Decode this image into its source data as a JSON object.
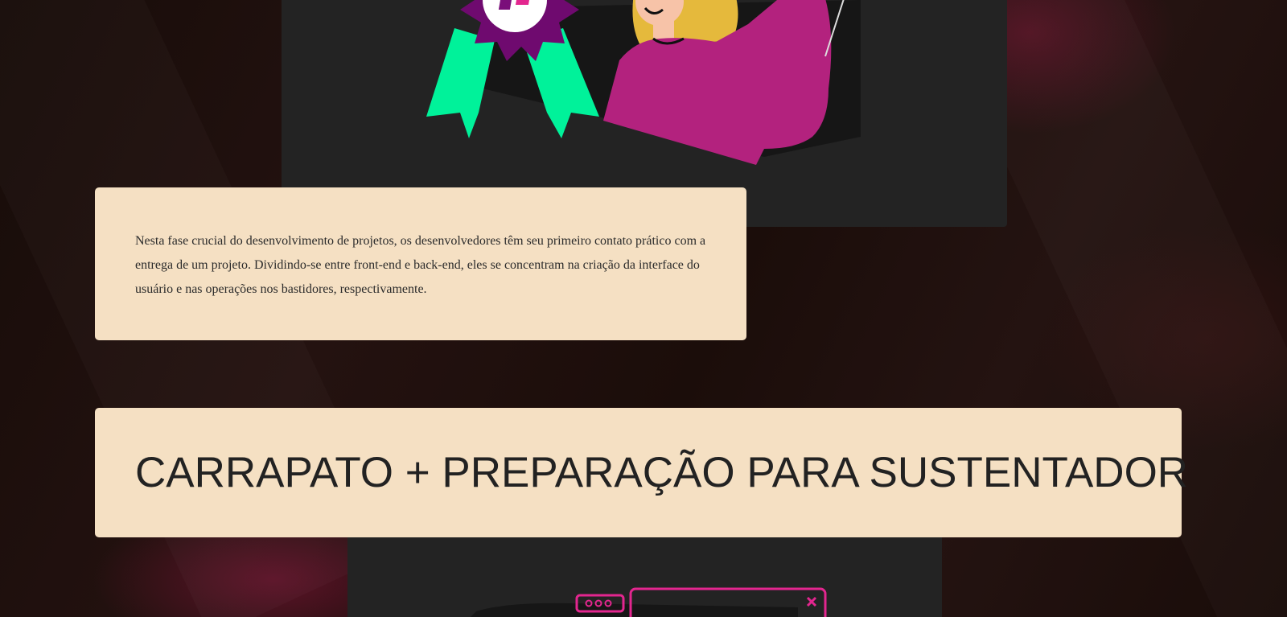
{
  "page": {
    "background_color": "#1d0f0b",
    "card_color": "#f5e0c3",
    "panel_color": "#232323"
  },
  "top_illustration": {
    "icon": "award-ribbon-celebrating-person-illustration",
    "colors": {
      "ribbon": "#00f29a",
      "badge": "#7a0f7a",
      "shirt": "#b3227e",
      "hair": "#e5b93c",
      "skin": "#f7c3a8"
    }
  },
  "description": {
    "text": "Nesta fase crucial do desenvolvimento de projetos, os desenvolvedores têm seu primeiro contato prático com a entrega de um projeto. Dividindo-se entre front-end e back-end, eles se concentram na criação da interface do usuário e nas operações nos bastidores, respectivamente."
  },
  "section": {
    "title": "CARRAPATO + PREPARAÇÃO PARA SUSTENTADOR"
  },
  "bottom_illustration": {
    "icon": "browser-windows-illustration",
    "accent_color": "#e3268f"
  }
}
